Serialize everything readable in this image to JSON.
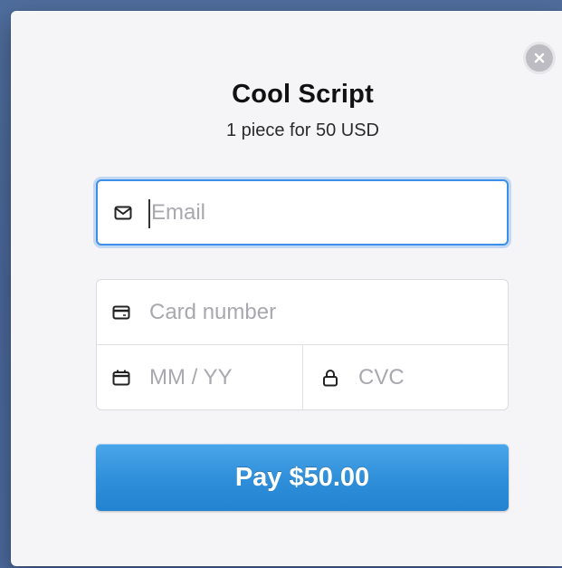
{
  "checkout": {
    "title": "Cool Script",
    "subtitle": "1 piece for 50 USD",
    "email_placeholder": "Email",
    "card_number_placeholder": "Card number",
    "expiry_placeholder": "MM / YY",
    "cvc_placeholder": "CVC",
    "pay_label": "Pay $50.00"
  },
  "icons": {
    "close": "close-icon",
    "email": "envelope-icon",
    "card": "credit-card-icon",
    "expiry": "calendar-icon",
    "cvc": "lock-icon"
  },
  "colors": {
    "accent": "#2e8ed9",
    "focus_border": "#3b8fe8",
    "modal_bg": "#f5f5f7",
    "page_bg": "#4b6a9d"
  }
}
